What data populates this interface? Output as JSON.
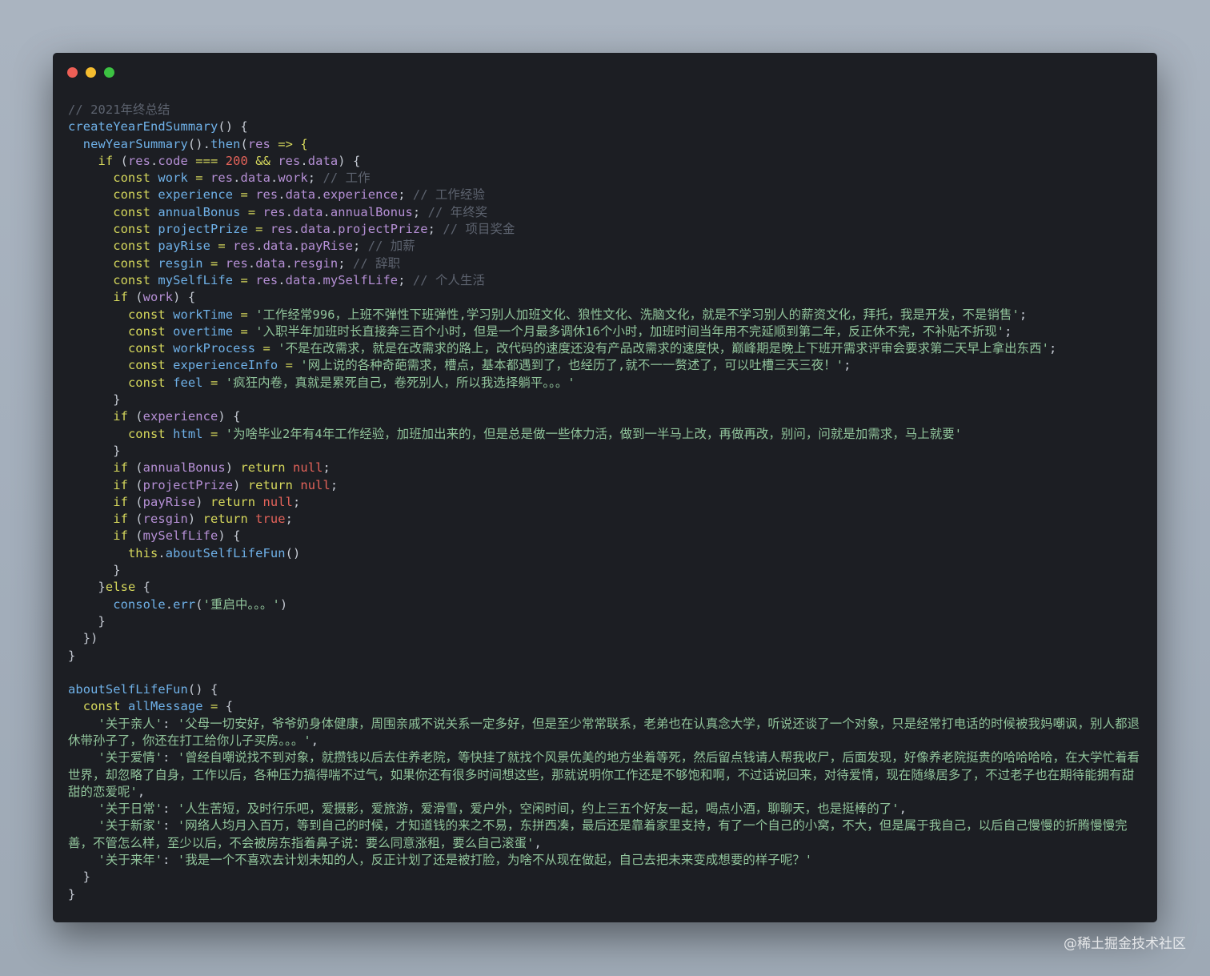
{
  "window": {
    "controls": [
      {
        "name": "close-dot",
        "color": "#ed5f56"
      },
      {
        "name": "minimize-dot",
        "color": "#f5bd2f"
      },
      {
        "name": "maximize-dot",
        "color": "#3cc242"
      }
    ]
  },
  "code_lines": [
    [
      {
        "t": "// 2021年终总结",
        "c": "c"
      }
    ],
    [
      {
        "t": "createYearEndSummary",
        "c": "f"
      },
      {
        "t": "() {",
        "c": "p"
      }
    ],
    [
      {
        "t": "  ",
        "c": "p"
      },
      {
        "t": "newYearSummary",
        "c": "f"
      },
      {
        "t": "().",
        "c": "p"
      },
      {
        "t": "then",
        "c": "f"
      },
      {
        "t": "(",
        "c": "p"
      },
      {
        "t": "res",
        "c": "v"
      },
      {
        "t": " => {",
        "c": "k"
      }
    ],
    [
      {
        "t": "    ",
        "c": "p"
      },
      {
        "t": "if",
        "c": "k"
      },
      {
        "t": " (",
        "c": "p"
      },
      {
        "t": "res",
        "c": "v"
      },
      {
        "t": ".",
        "c": "p"
      },
      {
        "t": "code",
        "c": "v"
      },
      {
        "t": " === ",
        "c": "k"
      },
      {
        "t": "200",
        "c": "n"
      },
      {
        "t": " && ",
        "c": "k"
      },
      {
        "t": "res",
        "c": "v"
      },
      {
        "t": ".",
        "c": "p"
      },
      {
        "t": "data",
        "c": "v"
      },
      {
        "t": ") {",
        "c": "p"
      }
    ],
    [
      {
        "t": "      ",
        "c": "p"
      },
      {
        "t": "const",
        "c": "k"
      },
      {
        "t": " work ",
        "c": "f"
      },
      {
        "t": "= ",
        "c": "k"
      },
      {
        "t": "res",
        "c": "v"
      },
      {
        "t": ".",
        "c": "p"
      },
      {
        "t": "data",
        "c": "v"
      },
      {
        "t": ".",
        "c": "p"
      },
      {
        "t": "work",
        "c": "v"
      },
      {
        "t": "; ",
        "c": "p"
      },
      {
        "t": "// 工作",
        "c": "c"
      }
    ],
    [
      {
        "t": "      ",
        "c": "p"
      },
      {
        "t": "const",
        "c": "k"
      },
      {
        "t": " experience ",
        "c": "f"
      },
      {
        "t": "= ",
        "c": "k"
      },
      {
        "t": "res",
        "c": "v"
      },
      {
        "t": ".",
        "c": "p"
      },
      {
        "t": "data",
        "c": "v"
      },
      {
        "t": ".",
        "c": "p"
      },
      {
        "t": "experience",
        "c": "v"
      },
      {
        "t": "; ",
        "c": "p"
      },
      {
        "t": "// 工作经验",
        "c": "c"
      }
    ],
    [
      {
        "t": "      ",
        "c": "p"
      },
      {
        "t": "const",
        "c": "k"
      },
      {
        "t": " annualBonus ",
        "c": "f"
      },
      {
        "t": "= ",
        "c": "k"
      },
      {
        "t": "res",
        "c": "v"
      },
      {
        "t": ".",
        "c": "p"
      },
      {
        "t": "data",
        "c": "v"
      },
      {
        "t": ".",
        "c": "p"
      },
      {
        "t": "annualBonus",
        "c": "v"
      },
      {
        "t": "; ",
        "c": "p"
      },
      {
        "t": "// 年终奖",
        "c": "c"
      }
    ],
    [
      {
        "t": "      ",
        "c": "p"
      },
      {
        "t": "const",
        "c": "k"
      },
      {
        "t": " projectPrize ",
        "c": "f"
      },
      {
        "t": "= ",
        "c": "k"
      },
      {
        "t": "res",
        "c": "v"
      },
      {
        "t": ".",
        "c": "p"
      },
      {
        "t": "data",
        "c": "v"
      },
      {
        "t": ".",
        "c": "p"
      },
      {
        "t": "projectPrize",
        "c": "v"
      },
      {
        "t": "; ",
        "c": "p"
      },
      {
        "t": "// 项目奖金",
        "c": "c"
      }
    ],
    [
      {
        "t": "      ",
        "c": "p"
      },
      {
        "t": "const",
        "c": "k"
      },
      {
        "t": " payRise ",
        "c": "f"
      },
      {
        "t": "= ",
        "c": "k"
      },
      {
        "t": "res",
        "c": "v"
      },
      {
        "t": ".",
        "c": "p"
      },
      {
        "t": "data",
        "c": "v"
      },
      {
        "t": ".",
        "c": "p"
      },
      {
        "t": "payRise",
        "c": "v"
      },
      {
        "t": "; ",
        "c": "p"
      },
      {
        "t": "// 加薪",
        "c": "c"
      }
    ],
    [
      {
        "t": "      ",
        "c": "p"
      },
      {
        "t": "const",
        "c": "k"
      },
      {
        "t": " resgin ",
        "c": "f"
      },
      {
        "t": "= ",
        "c": "k"
      },
      {
        "t": "res",
        "c": "v"
      },
      {
        "t": ".",
        "c": "p"
      },
      {
        "t": "data",
        "c": "v"
      },
      {
        "t": ".",
        "c": "p"
      },
      {
        "t": "resgin",
        "c": "v"
      },
      {
        "t": "; ",
        "c": "p"
      },
      {
        "t": "// 辞职",
        "c": "c"
      }
    ],
    [
      {
        "t": "      ",
        "c": "p"
      },
      {
        "t": "const",
        "c": "k"
      },
      {
        "t": " mySelfLife ",
        "c": "f"
      },
      {
        "t": "= ",
        "c": "k"
      },
      {
        "t": "res",
        "c": "v"
      },
      {
        "t": ".",
        "c": "p"
      },
      {
        "t": "data",
        "c": "v"
      },
      {
        "t": ".",
        "c": "p"
      },
      {
        "t": "mySelfLife",
        "c": "v"
      },
      {
        "t": "; ",
        "c": "p"
      },
      {
        "t": "// 个人生活",
        "c": "c"
      }
    ],
    [
      {
        "t": "      ",
        "c": "p"
      },
      {
        "t": "if",
        "c": "k"
      },
      {
        "t": " (",
        "c": "p"
      },
      {
        "t": "work",
        "c": "v"
      },
      {
        "t": ") {",
        "c": "p"
      }
    ],
    [
      {
        "t": "        ",
        "c": "p"
      },
      {
        "t": "const",
        "c": "k"
      },
      {
        "t": " workTime ",
        "c": "f"
      },
      {
        "t": "= ",
        "c": "k"
      },
      {
        "t": "'工作经常996，上班不弹性下班弹性,学习别人加班文化、狼性文化、洗脑文化，就是不学习别人的薪资文化，拜托，我是开发，不是销售'",
        "c": "s"
      },
      {
        "t": ";",
        "c": "p"
      }
    ],
    [
      {
        "t": "        ",
        "c": "p"
      },
      {
        "t": "const",
        "c": "k"
      },
      {
        "t": " overtime ",
        "c": "f"
      },
      {
        "t": "= ",
        "c": "k"
      },
      {
        "t": "'入职半年加班时长直接奔三百个小时，但是一个月最多调休16个小时，加班时间当年用不完延顺到第二年，反正休不完，不补贴不折现'",
        "c": "s"
      },
      {
        "t": ";",
        "c": "p"
      }
    ],
    [
      {
        "t": "        ",
        "c": "p"
      },
      {
        "t": "const",
        "c": "k"
      },
      {
        "t": " workProcess ",
        "c": "f"
      },
      {
        "t": "= ",
        "c": "k"
      },
      {
        "t": "'不是在改需求，就是在改需求的路上，改代码的速度还没有产品改需求的速度快，巅峰期是晚上下班开需求评审会要求第二天早上拿出东西'",
        "c": "s"
      },
      {
        "t": ";",
        "c": "p"
      }
    ],
    [
      {
        "t": "        ",
        "c": "p"
      },
      {
        "t": "const",
        "c": "k"
      },
      {
        "t": " experienceInfo ",
        "c": "f"
      },
      {
        "t": "= ",
        "c": "k"
      },
      {
        "t": "'网上说的各种奇葩需求，槽点，基本都遇到了，也经历了,就不一一赘述了，可以吐槽三天三夜！'",
        "c": "s"
      },
      {
        "t": ";",
        "c": "p"
      }
    ],
    [
      {
        "t": "        ",
        "c": "p"
      },
      {
        "t": "const",
        "c": "k"
      },
      {
        "t": " feel ",
        "c": "f"
      },
      {
        "t": "= ",
        "c": "k"
      },
      {
        "t": "'疯狂内卷，真就是累死自己，卷死别人，所以我选择躺平。。。'",
        "c": "s"
      }
    ],
    [
      {
        "t": "      }",
        "c": "p"
      }
    ],
    [
      {
        "t": "      ",
        "c": "p"
      },
      {
        "t": "if",
        "c": "k"
      },
      {
        "t": " (",
        "c": "p"
      },
      {
        "t": "experience",
        "c": "v"
      },
      {
        "t": ") {",
        "c": "p"
      }
    ],
    [
      {
        "t": "        ",
        "c": "p"
      },
      {
        "t": "const",
        "c": "k"
      },
      {
        "t": " html ",
        "c": "f"
      },
      {
        "t": "= ",
        "c": "k"
      },
      {
        "t": "'为啥毕业2年有4年工作经验，加班加出来的，但是总是做一些体力活，做到一半马上改，再做再改，别问，问就是加需求，马上就要'",
        "c": "s"
      }
    ],
    [
      {
        "t": "      }",
        "c": "p"
      }
    ],
    [
      {
        "t": "      ",
        "c": "p"
      },
      {
        "t": "if",
        "c": "k"
      },
      {
        "t": " (",
        "c": "p"
      },
      {
        "t": "annualBonus",
        "c": "v"
      },
      {
        "t": ") ",
        "c": "p"
      },
      {
        "t": "return",
        "c": "k"
      },
      {
        "t": " null",
        "c": "n"
      },
      {
        "t": ";",
        "c": "p"
      }
    ],
    [
      {
        "t": "      ",
        "c": "p"
      },
      {
        "t": "if",
        "c": "k"
      },
      {
        "t": " (",
        "c": "p"
      },
      {
        "t": "projectPrize",
        "c": "v"
      },
      {
        "t": ") ",
        "c": "p"
      },
      {
        "t": "return",
        "c": "k"
      },
      {
        "t": " null",
        "c": "n"
      },
      {
        "t": ";",
        "c": "p"
      }
    ],
    [
      {
        "t": "      ",
        "c": "p"
      },
      {
        "t": "if",
        "c": "k"
      },
      {
        "t": " (",
        "c": "p"
      },
      {
        "t": "payRise",
        "c": "v"
      },
      {
        "t": ") ",
        "c": "p"
      },
      {
        "t": "return",
        "c": "k"
      },
      {
        "t": " null",
        "c": "n"
      },
      {
        "t": ";",
        "c": "p"
      }
    ],
    [
      {
        "t": "      ",
        "c": "p"
      },
      {
        "t": "if",
        "c": "k"
      },
      {
        "t": " (",
        "c": "p"
      },
      {
        "t": "resgin",
        "c": "v"
      },
      {
        "t": ") ",
        "c": "p"
      },
      {
        "t": "return",
        "c": "k"
      },
      {
        "t": " true",
        "c": "n"
      },
      {
        "t": ";",
        "c": "p"
      }
    ],
    [
      {
        "t": "      ",
        "c": "p"
      },
      {
        "t": "if",
        "c": "k"
      },
      {
        "t": " (",
        "c": "p"
      },
      {
        "t": "mySelfLife",
        "c": "v"
      },
      {
        "t": ") {",
        "c": "p"
      }
    ],
    [
      {
        "t": "        ",
        "c": "p"
      },
      {
        "t": "this",
        "c": "k"
      },
      {
        "t": ".",
        "c": "p"
      },
      {
        "t": "aboutSelfLifeFun",
        "c": "f"
      },
      {
        "t": "()",
        "c": "p"
      }
    ],
    [
      {
        "t": "      }",
        "c": "p"
      }
    ],
    [
      {
        "t": "    }",
        "c": "p"
      },
      {
        "t": "else",
        "c": "k"
      },
      {
        "t": " {",
        "c": "p"
      }
    ],
    [
      {
        "t": "      ",
        "c": "p"
      },
      {
        "t": "console",
        "c": "f"
      },
      {
        "t": ".",
        "c": "p"
      },
      {
        "t": "err",
        "c": "f"
      },
      {
        "t": "(",
        "c": "p"
      },
      {
        "t": "'重启中。。。'",
        "c": "s"
      },
      {
        "t": ")",
        "c": "p"
      }
    ],
    [
      {
        "t": "    }",
        "c": "p"
      }
    ],
    [
      {
        "t": "  })",
        "c": "p"
      }
    ],
    [
      {
        "t": "}",
        "c": "p"
      }
    ],
    [
      {
        "t": "",
        "c": "p"
      }
    ],
    [
      {
        "t": "aboutSelfLifeFun",
        "c": "f"
      },
      {
        "t": "() {",
        "c": "p"
      }
    ],
    [
      {
        "t": "  ",
        "c": "p"
      },
      {
        "t": "const",
        "c": "k"
      },
      {
        "t": " allMessage ",
        "c": "f"
      },
      {
        "t": "= ",
        "c": "k"
      },
      {
        "t": "{",
        "c": "p"
      }
    ],
    {
      "wrap": true,
      "tokens": [
        {
          "t": "    '关于亲人'",
          "c": "s"
        },
        {
          "t": ": ",
          "c": "p"
        },
        {
          "t": "'父母一切安好，爷爷奶身体健康，周围亲戚不说关系一定多好，但是至少常常联系，老弟也在认真念大学，听说还谈了一个对象，只是经常打电话的时候被我妈嘲讽，别人都退休带孙子了，你还在打工给你儿子买房。。。'",
          "c": "s"
        },
        {
          "t": ",",
          "c": "p"
        }
      ]
    },
    {
      "wrap": true,
      "tokens": [
        {
          "t": "    '关于爱情'",
          "c": "s"
        },
        {
          "t": ": ",
          "c": "p"
        },
        {
          "t": "'曾经自嘲说找不到对象，就攒钱以后去住养老院，等快挂了就找个风景优美的地方坐着等死，然后留点钱请人帮我收尸，后面发现，好像养老院挺贵的哈哈哈哈，在大学忙着看世界，却忽略了自身，工作以后，各种压力搞得喘不过气，如果你还有很多时间想这些，那就说明你工作还是不够饱和啊，不过话说回来，对待爱情，现在随缘居多了，不过老子也在期待能拥有甜甜的恋爱呢'",
          "c": "s"
        },
        {
          "t": ",",
          "c": "p"
        }
      ]
    },
    {
      "wrap": true,
      "tokens": [
        {
          "t": "    '关于日常'",
          "c": "s"
        },
        {
          "t": ": ",
          "c": "p"
        },
        {
          "t": "'人生苦短，及时行乐吧，爱摄影，爱旅游，爱滑雪，爱户外，空闲时间，约上三五个好友一起，喝点小酒，聊聊天，也是挺棒的了'",
          "c": "s"
        },
        {
          "t": ",",
          "c": "p"
        }
      ]
    },
    {
      "wrap": true,
      "tokens": [
        {
          "t": "    '关于新家'",
          "c": "s"
        },
        {
          "t": ": ",
          "c": "p"
        },
        {
          "t": "'网络人均月入百万，等到自己的时候，才知道钱的来之不易，东拼西凑，最后还是靠着家里支持，有了一个自己的小窝，不大，但是属于我自己，以后自己慢慢的折腾慢慢完善，不管怎么样，至少以后，不会被房东指着鼻子说：要么同意涨租，要么自己滚蛋'",
          "c": "s"
        },
        {
          "t": ",",
          "c": "p"
        }
      ]
    },
    {
      "wrap": true,
      "tokens": [
        {
          "t": "    '关于来年'",
          "c": "s"
        },
        {
          "t": ": ",
          "c": "p"
        },
        {
          "t": "'我是一个不喜欢去计划未知的人，反正计划了还是被打脸，为啥不从现在做起，自己去把未来变成想要的样子呢？'",
          "c": "s"
        }
      ]
    },
    [
      {
        "t": "  }",
        "c": "p"
      }
    ],
    [
      {
        "t": "}",
        "c": "p"
      }
    ]
  ],
  "watermark": "@稀土掘金技术社区"
}
